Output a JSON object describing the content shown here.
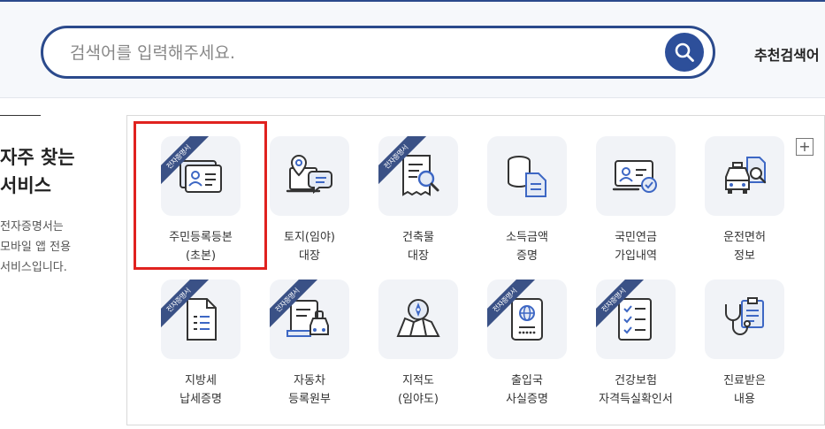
{
  "search": {
    "placeholder": "검색어를 입력해주세요.",
    "recommend_label": "추천검색어"
  },
  "sidebar": {
    "title_line1": "자주 찾는",
    "title_line2": "서비스",
    "desc_line1": "전자증명서는",
    "desc_line2": "모바일 앱 전용",
    "desc_line3": "서비스입니다."
  },
  "panel": {
    "more_label": "+"
  },
  "ribbon_text": "전자증명서",
  "colors": {
    "primary": "#2b4a8c",
    "highlight": "#e0221f",
    "tile_bg": "#f1f3f7"
  },
  "services": [
    {
      "line1": "주민등록등본",
      "line2": "(초본)",
      "ribbon": true,
      "icon": "id-card-icon"
    },
    {
      "line1": "토지(임야)",
      "line2": "대장",
      "ribbon": false,
      "icon": "map-pin-chat-icon"
    },
    {
      "line1": "건축물",
      "line2": "대장",
      "ribbon": true,
      "icon": "receipt-search-icon"
    },
    {
      "line1": "소득금액",
      "line2": "증명",
      "ribbon": false,
      "icon": "coins-document-icon"
    },
    {
      "line1": "국민연금",
      "line2": "가입내역",
      "ribbon": false,
      "icon": "id-verified-icon"
    },
    {
      "line1": "운전면허",
      "line2": "정보",
      "ribbon": false,
      "icon": "car-license-icon"
    },
    {
      "line1": "지방세",
      "line2": "납세증명",
      "ribbon": true,
      "icon": "document-icon"
    },
    {
      "line1": "자동차",
      "line2": "등록원부",
      "ribbon": true,
      "icon": "car-document-icon"
    },
    {
      "line1": "지적도",
      "line2": "(임야도)",
      "ribbon": false,
      "icon": "map-compass-icon"
    },
    {
      "line1": "출입국",
      "line2": "사실증명",
      "ribbon": true,
      "icon": "passport-icon"
    },
    {
      "line1": "건강보험",
      "line2": "자격득실확인서",
      "ribbon": true,
      "icon": "checklist-icon"
    },
    {
      "line1": "진료받은",
      "line2": "내용",
      "ribbon": false,
      "icon": "stethoscope-icon"
    }
  ]
}
